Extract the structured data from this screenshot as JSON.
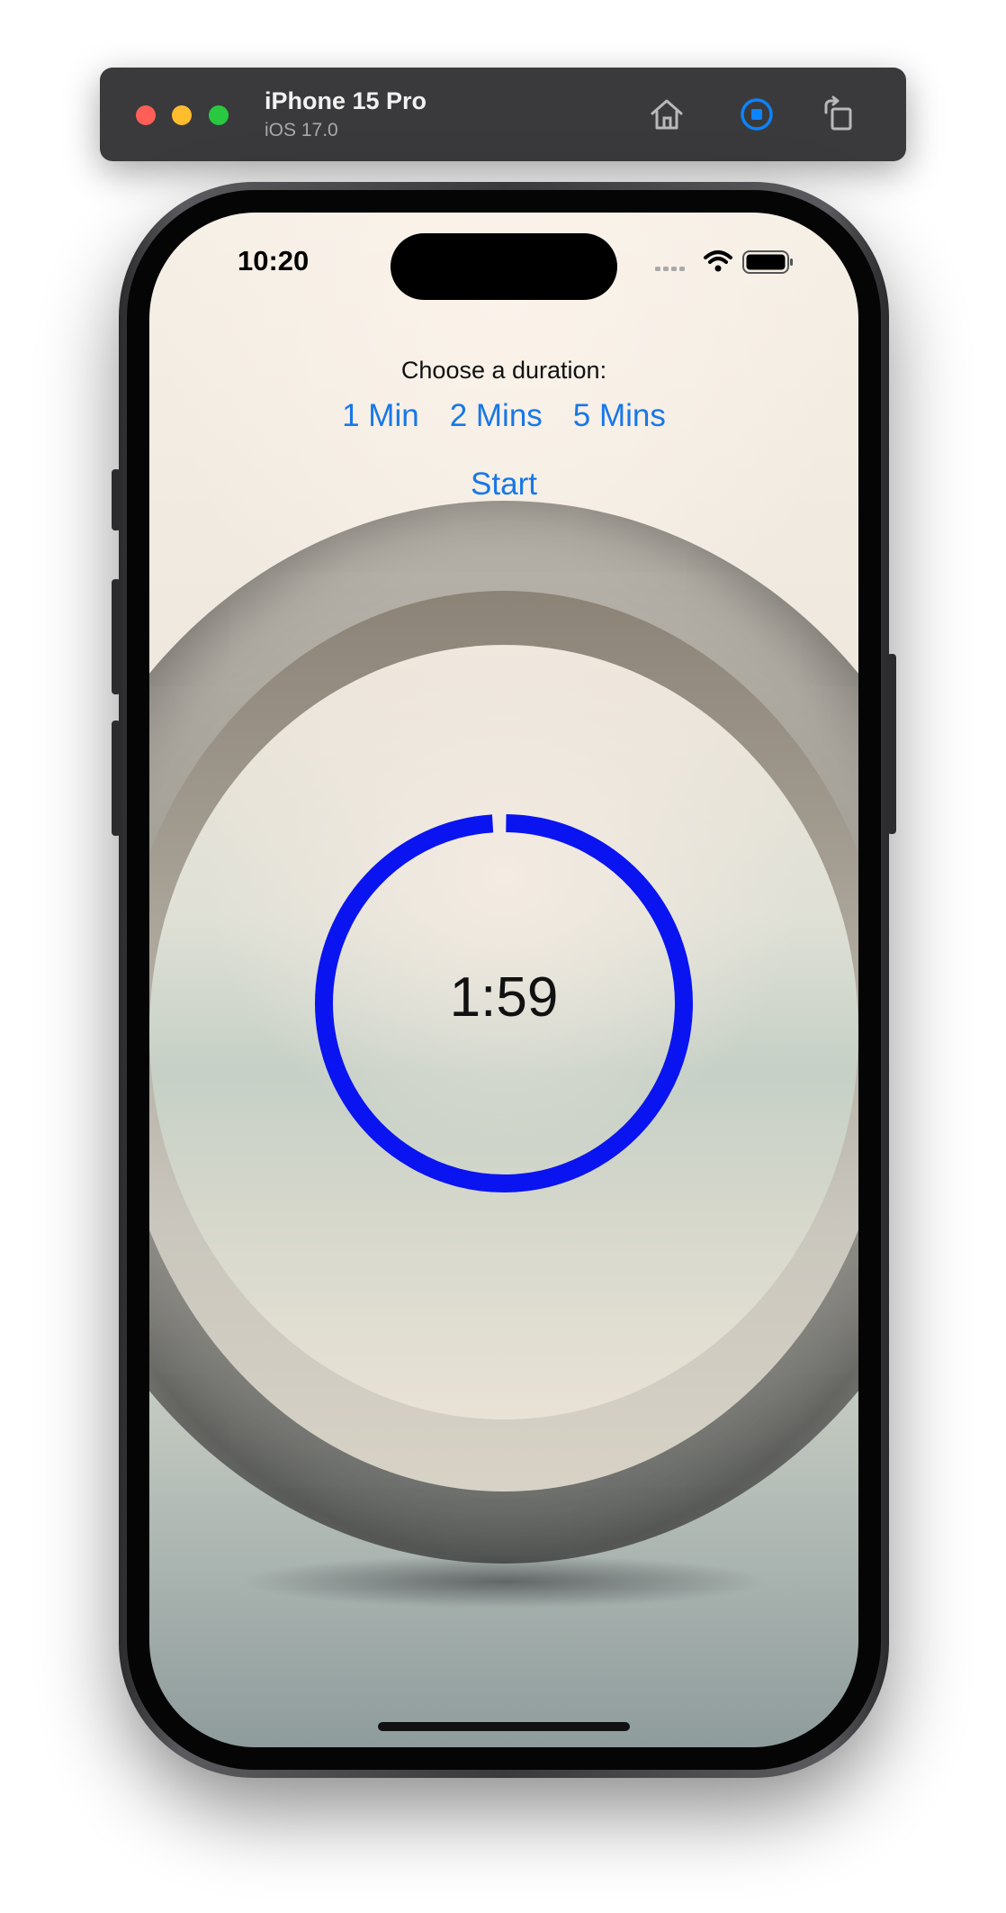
{
  "simulator": {
    "device_name": "iPhone 15 Pro",
    "os_version": "iOS 17.0",
    "icons": [
      "home-icon",
      "screenshot-icon",
      "rotate-icon"
    ],
    "accent_color": "#0a84ff"
  },
  "status_bar": {
    "time": "10:20",
    "icons": [
      "cellular-icon",
      "wifi-icon",
      "battery-icon"
    ]
  },
  "app": {
    "choose_label": "Choose a duration:",
    "durations": [
      "1 Min",
      "2 Mins",
      "5 Mins"
    ],
    "start_label": "Start",
    "timer_display": "1:59",
    "timer_progress_fraction": 0.992,
    "ring_color": "#0a14f0",
    "button_color": "#1877e8"
  }
}
